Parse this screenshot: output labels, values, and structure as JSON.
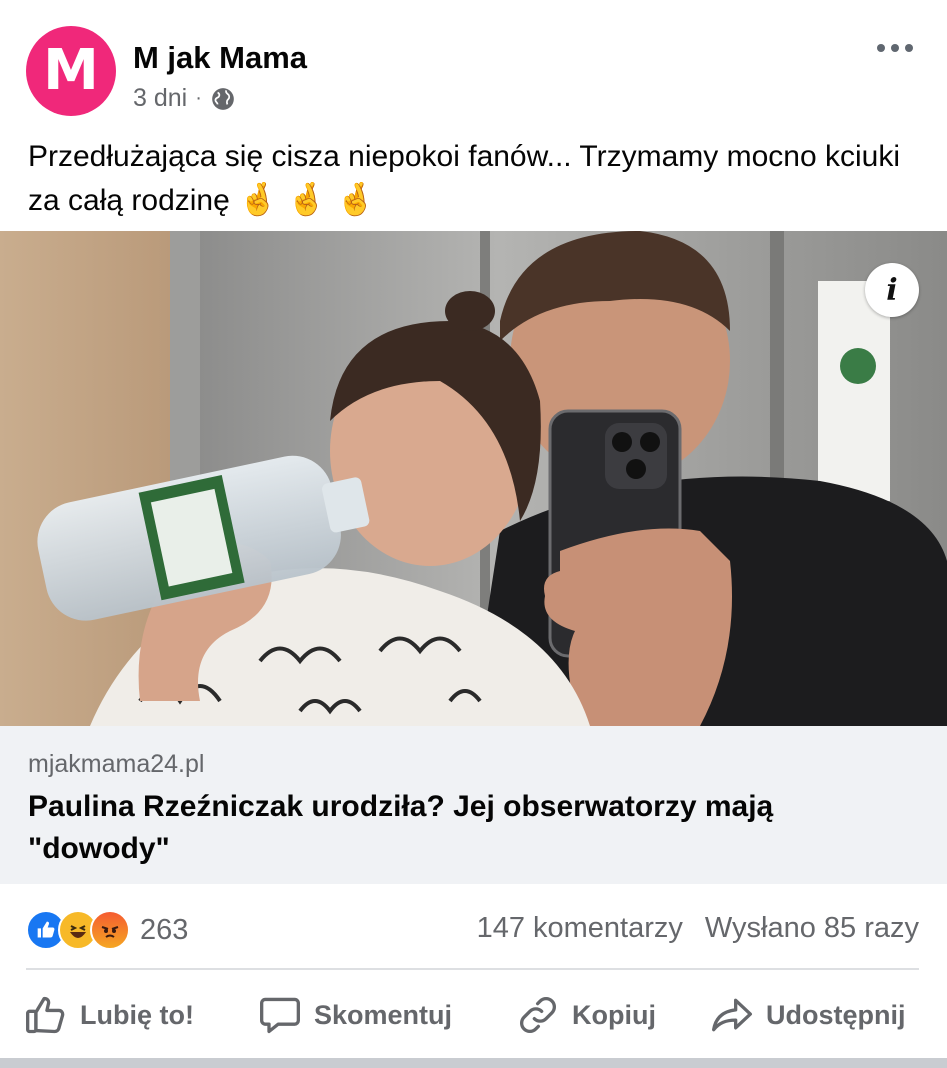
{
  "post": {
    "page_name": "M jak Mama",
    "avatar_letter": "M",
    "time": "3 dni",
    "separator": "·",
    "privacy_icon": "globe-icon",
    "more_icon": "more-horizontal-icon",
    "caption_text": "Przedłużająca się cisza niepokoi fanów... Trzymamy mocno kciuki za całą rodzinę",
    "caption_emojis": "🤞 🤞 🤞"
  },
  "image": {
    "info_label": "i"
  },
  "link": {
    "domain": "mjakmama24.pl",
    "title": "Paulina Rzeźniczak urodziła? Jej obserwatorzy mają \"dowody\""
  },
  "engagement": {
    "reaction_icons": [
      "like-reaction-icon",
      "haha-reaction-icon",
      "angry-reaction-icon"
    ],
    "reaction_count": "263",
    "comments": "147 komentarzy",
    "shares": "Wysłano 85 razy"
  },
  "actions": {
    "like": "Lubię to!",
    "comment": "Skomentuj",
    "copy": "Kopiuj",
    "share": "Udostępnij"
  },
  "colors": {
    "brand": "#f0287a",
    "secondary_text": "#65676b",
    "link_background": "#f0f2f5",
    "like_blue": "#1877f2"
  }
}
